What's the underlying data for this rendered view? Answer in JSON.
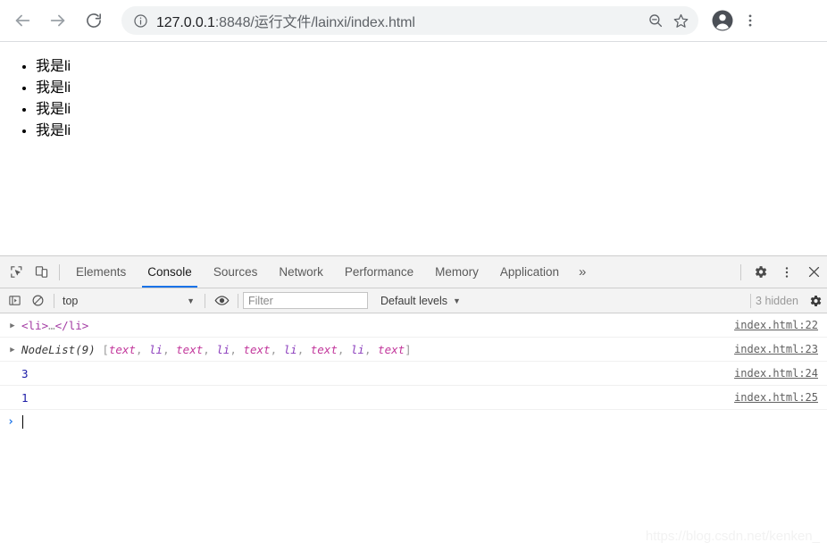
{
  "browser": {
    "nav": {
      "back_label": "Back",
      "forward_label": "Forward",
      "reload_label": "Reload"
    },
    "omnibox": {
      "site_info_icon": "info-circle-icon",
      "url_host": "127.0.0.1",
      "url_rest": ":8848/运行文件/lainxi/index.html",
      "url_full": "127.0.0.1:8848/运行文件/lainxi/index.html",
      "zoom_icon": "zoom-out-icon",
      "bookmark_icon": "star-icon"
    },
    "profile_icon": "account-avatar-icon",
    "menu_icon": "three-dot-menu-icon"
  },
  "page": {
    "list_items": [
      "我是li",
      "我是li",
      "我是li",
      "我是li"
    ]
  },
  "devtools": {
    "toolbar": {
      "inspect_icon": "inspect-element-icon",
      "device_icon": "device-toolbar-icon",
      "settings_icon": "gear-icon",
      "more_icon": "three-dot-menu-icon",
      "close_icon": "close-icon",
      "overflow_label": "»"
    },
    "tabs": [
      {
        "label": "Elements",
        "active": false
      },
      {
        "label": "Console",
        "active": true
      },
      {
        "label": "Sources",
        "active": false
      },
      {
        "label": "Network",
        "active": false
      },
      {
        "label": "Performance",
        "active": false
      },
      {
        "label": "Memory",
        "active": false
      },
      {
        "label": "Application",
        "active": false
      }
    ],
    "filterbar": {
      "execute_icon": "console-sidebar-icon",
      "clear_icon": "clear-console-icon",
      "context_value": "top",
      "eye_icon": "live-expression-eye-icon",
      "filter_value": "",
      "filter_placeholder": "Filter",
      "levels_value": "Default levels",
      "hidden_count": "3 hidden",
      "settings_icon": "gear-icon"
    },
    "console_rows": [
      {
        "expandable": true,
        "kind": "element",
        "tag_open": "<li>",
        "ellipsis": "…",
        "tag_close": "</li>",
        "source": "index.html:22"
      },
      {
        "expandable": true,
        "kind": "nodelist",
        "name": "NodeList(9)",
        "open_bracket": " [",
        "entries": [
          "text",
          "li",
          "text",
          "li",
          "text",
          "li",
          "text",
          "li",
          "text"
        ],
        "close_bracket": "]",
        "source": "index.html:23"
      },
      {
        "expandable": false,
        "kind": "number",
        "value": "3",
        "source": "index.html:24"
      },
      {
        "expandable": false,
        "kind": "number",
        "value": "1",
        "source": "index.html:25"
      }
    ],
    "prompt": {
      "chevron": "›",
      "value": ""
    }
  },
  "watermark": "https://blog.csdn.net/kenken_",
  "colors": {
    "accent": "#1a73e8",
    "omnibox_bg": "#f1f3f4",
    "devtools_bg": "#f3f3f3",
    "tag_purple": "#a33aa3",
    "text_magenta": "#c2369b",
    "li_purple": "#8c3fbd",
    "number_blue": "#1a1aa6"
  }
}
